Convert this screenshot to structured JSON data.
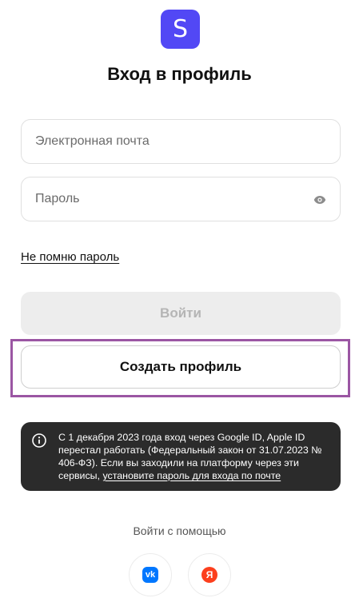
{
  "logo": {
    "letter": "S",
    "color": "#5248f5"
  },
  "title": "Вход в профиль",
  "fields": {
    "email": {
      "placeholder": "Электронная почта",
      "value": ""
    },
    "password": {
      "placeholder": "Пароль",
      "value": "",
      "toggle_icon": "eye-icon"
    }
  },
  "forgot_link": "Не помню пароль",
  "buttons": {
    "login": "Войти",
    "create_profile": "Создать профиль"
  },
  "highlight_color": "#9b56a3",
  "notice": {
    "icon": "info-icon",
    "text": "С 1 декабря 2023 года вход через Google ID, Apple ID перестал работать (Федеральный закон от 31.07.2023 № 406-ФЗ). Если вы заходили на платформу через эти сервисы, ",
    "link": "установите пароль для входа по почте"
  },
  "social": {
    "label": "Войти с помощью",
    "providers": [
      {
        "name": "VK",
        "glyph": "vk",
        "icon": "vk-icon",
        "color": "#0077ff"
      },
      {
        "name": "Yandex",
        "glyph": "Я",
        "icon": "yandex-icon",
        "color": "#fc3f1d"
      }
    ]
  }
}
